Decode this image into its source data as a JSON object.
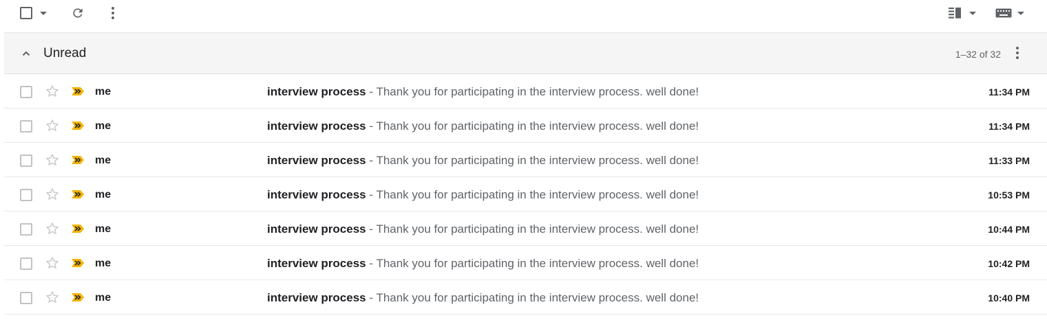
{
  "toolbar": {
    "select_all_icon": "checkbox-icon",
    "refresh_icon": "refresh-icon",
    "more_icon": "more-vert-icon",
    "split_pane_icon": "split-pane-icon",
    "keyboard_icon": "keyboard-icon"
  },
  "section": {
    "title": "Unread",
    "count": "1–32 of 32",
    "collapse_icon": "chevron-up-icon"
  },
  "colors": {
    "important_marker": "#f4b400",
    "star_outline": "#c9c9c9",
    "divider": "#e8e8e8",
    "section_bg": "#f5f5f5"
  },
  "emails": [
    {
      "sender": "me",
      "subject": "interview process",
      "snippet": "Thank you for participating in the interview process. well done!",
      "time": "11:34 PM"
    },
    {
      "sender": "me",
      "subject": "interview process",
      "snippet": "Thank you for participating in the interview process. well done!",
      "time": "11:34 PM"
    },
    {
      "sender": "me",
      "subject": "interview process",
      "snippet": "Thank you for participating in the interview process. well done!",
      "time": "11:33 PM"
    },
    {
      "sender": "me",
      "subject": "interview process",
      "snippet": "Thank you for participating in the interview process. well done!",
      "time": "10:53 PM"
    },
    {
      "sender": "me",
      "subject": "interview process",
      "snippet": "Thank you for participating in the interview process. well done!",
      "time": "10:44 PM"
    },
    {
      "sender": "me",
      "subject": "interview process",
      "snippet": "Thank you for participating in the interview process. well done!",
      "time": "10:42 PM"
    },
    {
      "sender": "me",
      "subject": "interview process",
      "snippet": "Thank you for participating in the interview process. well done!",
      "time": "10:40 PM"
    }
  ]
}
